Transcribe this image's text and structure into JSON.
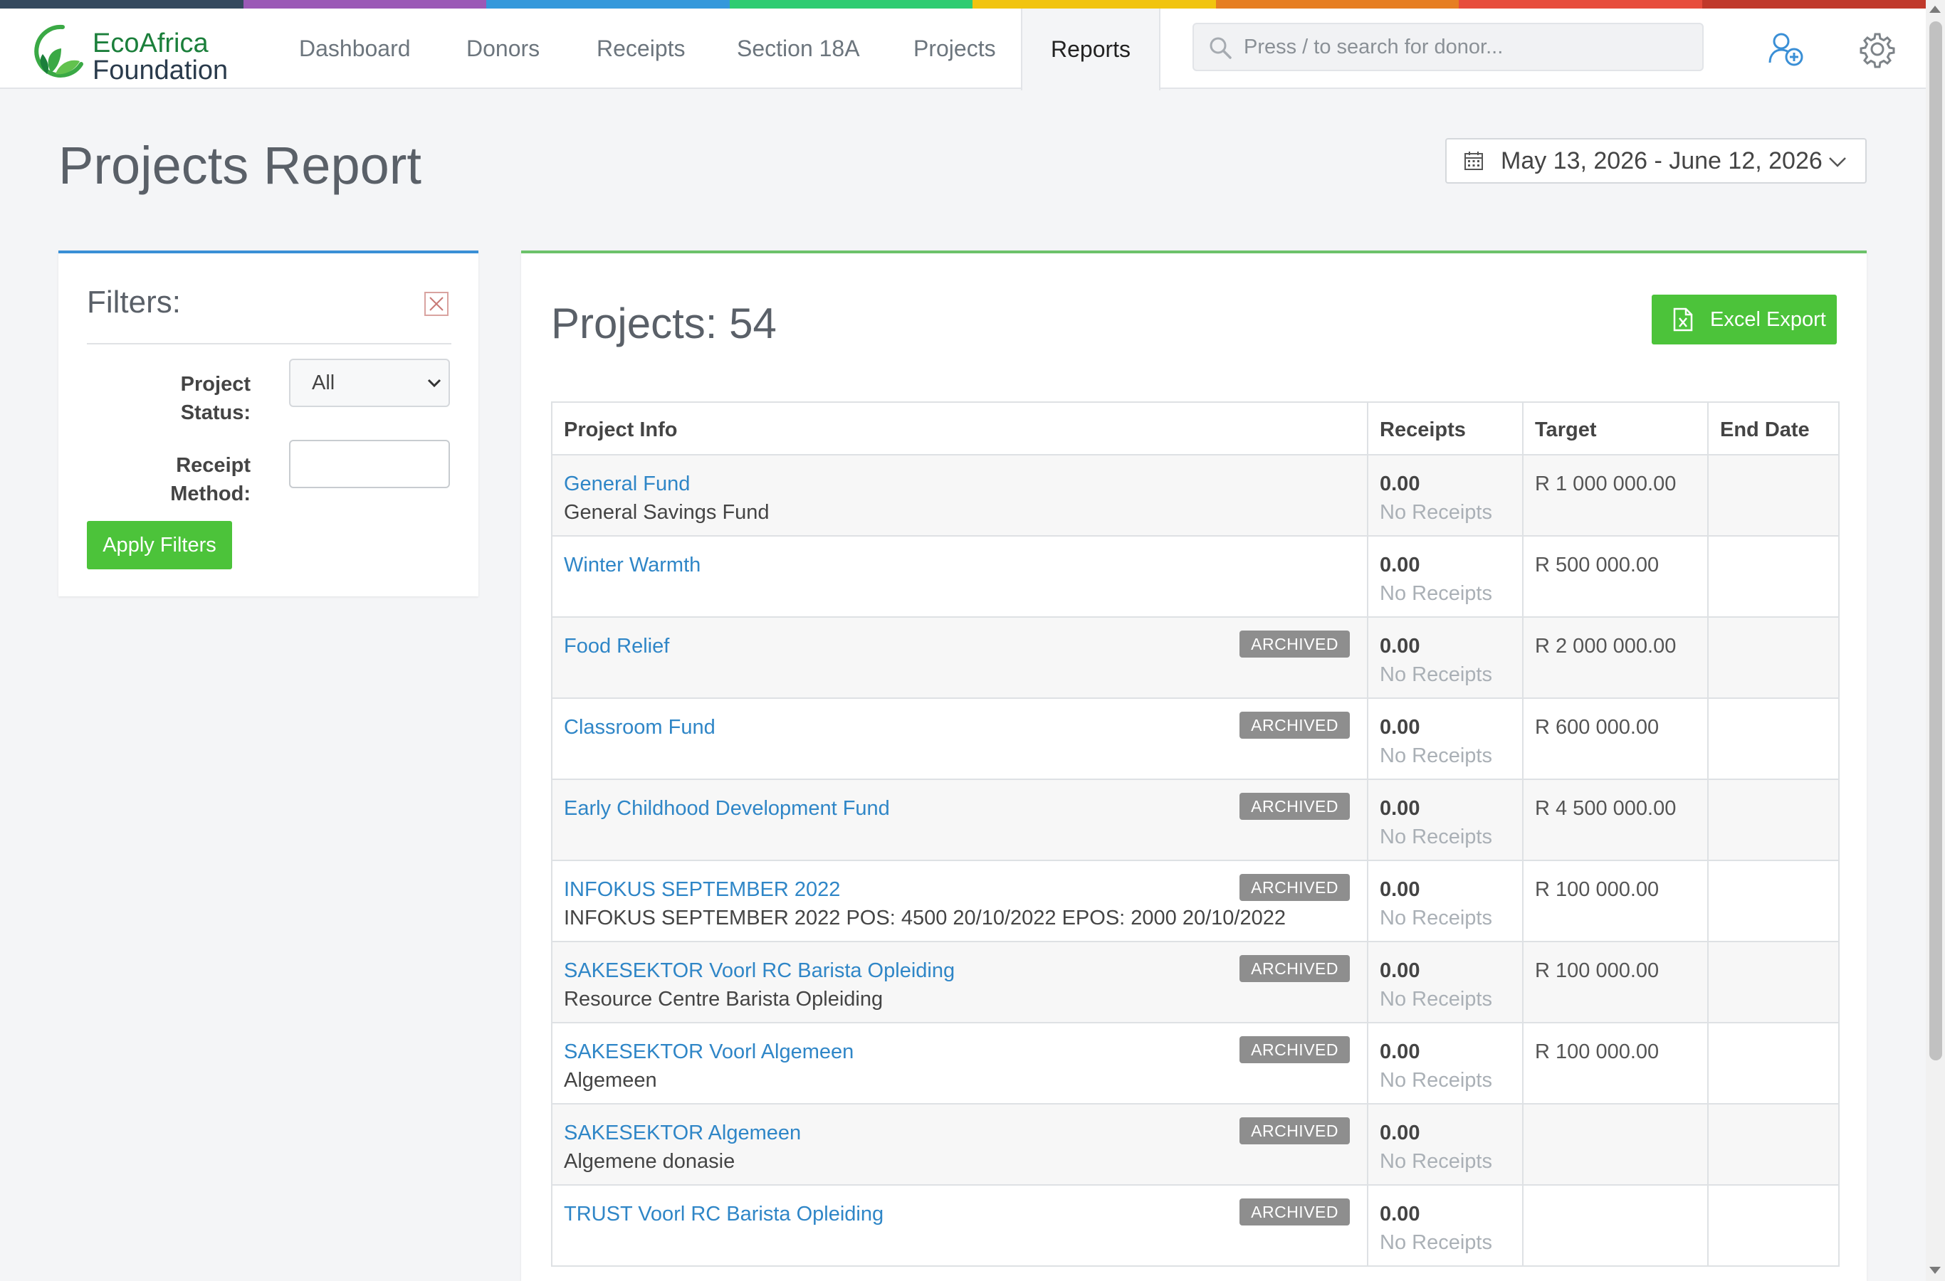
{
  "brand": {
    "name_line1": "EcoAfrica",
    "name_line2": "Foundation",
    "stripe_colors": [
      "#34495e",
      "#9b59b6",
      "#3498db",
      "#2ecc71",
      "#f1c40f",
      "#e67e22",
      "#e74c3c",
      "#c0392b"
    ]
  },
  "nav": {
    "items": [
      {
        "label": "Dashboard"
      },
      {
        "label": "Donors"
      },
      {
        "label": "Receipts"
      },
      {
        "label": "Section 18A"
      },
      {
        "label": "Projects"
      },
      {
        "label": "Reports",
        "active": true
      }
    ],
    "search_placeholder": "Press / to search for donor...",
    "icons": [
      "add-user-icon",
      "gear-icon"
    ]
  },
  "page": {
    "title": "Projects Report",
    "date_range": "May 13, 2026 - June 12, 2026"
  },
  "filters": {
    "title": "Filters:",
    "project_status_label_1": "Project",
    "project_status_label_2": "Status:",
    "project_status_value": "All",
    "receipt_method_label_1": "Receipt",
    "receipt_method_label_2": "Method:",
    "receipt_method_value": "",
    "apply_label": "Apply Filters"
  },
  "report": {
    "count_label": "Projects: 54",
    "export_label": "Excel Export",
    "columns": [
      "Project Info",
      "Receipts",
      "Target",
      "End Date"
    ],
    "rows": [
      {
        "name": "General Fund",
        "description": "General Savings Fund",
        "badge": "",
        "receipts": "0.00",
        "receipts_note": "No Receipts",
        "target": "R 1 000 000.00",
        "end_date": ""
      },
      {
        "name": "Winter Warmth",
        "description": "",
        "badge": "",
        "receipts": "0.00",
        "receipts_note": "No Receipts",
        "target": "R 500 000.00",
        "end_date": ""
      },
      {
        "name": "Food Relief",
        "description": "",
        "badge": "ARCHIVED",
        "receipts": "0.00",
        "receipts_note": "No Receipts",
        "target": "R 2 000 000.00",
        "end_date": ""
      },
      {
        "name": "Classroom Fund",
        "description": "",
        "badge": "ARCHIVED",
        "receipts": "0.00",
        "receipts_note": "No Receipts",
        "target": "R 600 000.00",
        "end_date": ""
      },
      {
        "name": "Early Childhood Development Fund",
        "description": "",
        "badge": "ARCHIVED",
        "receipts": "0.00",
        "receipts_note": "No Receipts",
        "target": "R 4 500 000.00",
        "end_date": ""
      },
      {
        "name": "INFOKUS SEPTEMBER 2022",
        "description": "INFOKUS SEPTEMBER 2022 POS: 4500 20/10/2022 EPOS: 2000 20/10/2022",
        "badge": "ARCHIVED",
        "receipts": "0.00",
        "receipts_note": "No Receipts",
        "target": "R 100 000.00",
        "end_date": ""
      },
      {
        "name": "SAKESEKTOR Voorl RC Barista Opleiding",
        "description": "Resource Centre Barista Opleiding",
        "badge": "ARCHIVED",
        "receipts": "0.00",
        "receipts_note": "No Receipts",
        "target": "R 100 000.00",
        "end_date": ""
      },
      {
        "name": "SAKESEKTOR Voorl Algemeen",
        "description": "Algemeen",
        "badge": "ARCHIVED",
        "receipts": "0.00",
        "receipts_note": "No Receipts",
        "target": "R 100 000.00",
        "end_date": ""
      },
      {
        "name": "SAKESEKTOR Algemeen",
        "description": "Algemene donasie",
        "badge": "ARCHIVED",
        "receipts": "0.00",
        "receipts_note": "No Receipts",
        "target": "",
        "end_date": ""
      },
      {
        "name": "TRUST Voorl RC Barista Opleiding",
        "description": "",
        "badge": "ARCHIVED",
        "receipts": "0.00",
        "receipts_note": "No Receipts",
        "target": "",
        "end_date": ""
      }
    ]
  }
}
